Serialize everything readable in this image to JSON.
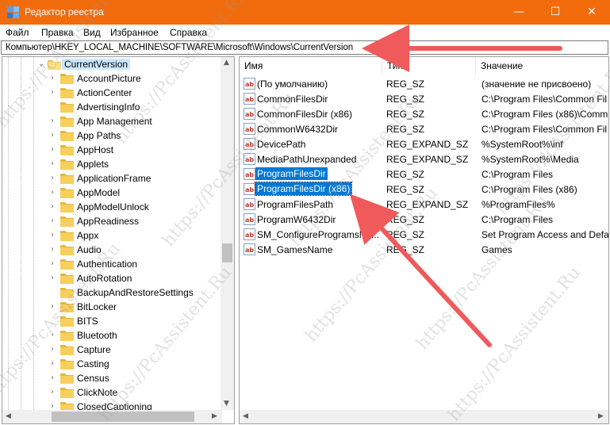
{
  "window": {
    "title": "Редактор реестра",
    "controls": {
      "minimize": "—",
      "maximize": "☐",
      "close": "✕"
    }
  },
  "menu": [
    "Файл",
    "Правка",
    "Вид",
    "Избранное",
    "Справка"
  ],
  "address": "Компьютер\\HKEY_LOCAL_MACHINE\\SOFTWARE\\Microsoft\\Windows\\CurrentVersion",
  "tree": {
    "root": "CurrentVersion",
    "children": [
      {
        "label": "AccountPicture",
        "expandable": true
      },
      {
        "label": "ActionCenter",
        "expandable": true
      },
      {
        "label": "AdvertisingInfo",
        "expandable": false
      },
      {
        "label": "App Management",
        "expandable": true
      },
      {
        "label": "App Paths",
        "expandable": true
      },
      {
        "label": "AppHost",
        "expandable": true
      },
      {
        "label": "Applets",
        "expandable": true
      },
      {
        "label": "ApplicationFrame",
        "expandable": true
      },
      {
        "label": "AppModel",
        "expandable": true
      },
      {
        "label": "AppModelUnlock",
        "expandable": true
      },
      {
        "label": "AppReadiness",
        "expandable": true
      },
      {
        "label": "Appx",
        "expandable": true
      },
      {
        "label": "Audio",
        "expandable": true
      },
      {
        "label": "Authentication",
        "expandable": true
      },
      {
        "label": "AutoRotation",
        "expandable": true
      },
      {
        "label": "BackupAndRestoreSettings",
        "expandable": false
      },
      {
        "label": "BitLocker",
        "expandable": true
      },
      {
        "label": "BITS",
        "expandable": false
      },
      {
        "label": "Bluetooth",
        "expandable": true
      },
      {
        "label": "Capture",
        "expandable": true
      },
      {
        "label": "Casting",
        "expandable": true
      },
      {
        "label": "Census",
        "expandable": true
      },
      {
        "label": "ClickNote",
        "expandable": true
      },
      {
        "label": "ClosedCaptioning",
        "expandable": true
      }
    ]
  },
  "list": {
    "columns": [
      "Имя",
      "Тип",
      "Значение"
    ],
    "rows": [
      {
        "name": "(По умолчанию)",
        "type": "REG_SZ",
        "data": "(значение не присвоено)"
      },
      {
        "name": "CommonFilesDir",
        "type": "REG_SZ",
        "data": "C:\\Program Files\\Common Fil"
      },
      {
        "name": "CommonFilesDir (x86)",
        "type": "REG_SZ",
        "data": "C:\\Program Files (x86)\\Comm"
      },
      {
        "name": "CommonW6432Dir",
        "type": "REG_SZ",
        "data": "C:\\Program Files\\Common Fil"
      },
      {
        "name": "DevicePath",
        "type": "REG_EXPAND_SZ",
        "data": "%SystemRoot%\\inf"
      },
      {
        "name": "MediaPathUnexpanded",
        "type": "REG_EXPAND_SZ",
        "data": "%SystemRoot%\\Media"
      },
      {
        "name": "ProgramFilesDir",
        "type": "REG_SZ",
        "data": "C:\\Program Files"
      },
      {
        "name": "ProgramFilesDir (x86)",
        "type": "REG_SZ",
        "data": "C:\\Program Files (x86)"
      },
      {
        "name": "ProgramFilesPath",
        "type": "REG_EXPAND_SZ",
        "data": "%ProgramFiles%"
      },
      {
        "name": "ProgramW6432Dir",
        "type": "REG_SZ",
        "data": "C:\\Program Files"
      },
      {
        "name": "SM_ConfigureProgramsNa...",
        "type": "REG_SZ",
        "data": "Set Program Access and Defau"
      },
      {
        "name": "SM_GamesName",
        "type": "REG_SZ",
        "data": "Games"
      }
    ]
  },
  "watermark": "https://PcAssistent.Ru",
  "colors": {
    "titlebar": "#f26c0d",
    "selection": "#0078d7",
    "arrow": "#f05a5a",
    "folder": "#f7cf5c"
  }
}
